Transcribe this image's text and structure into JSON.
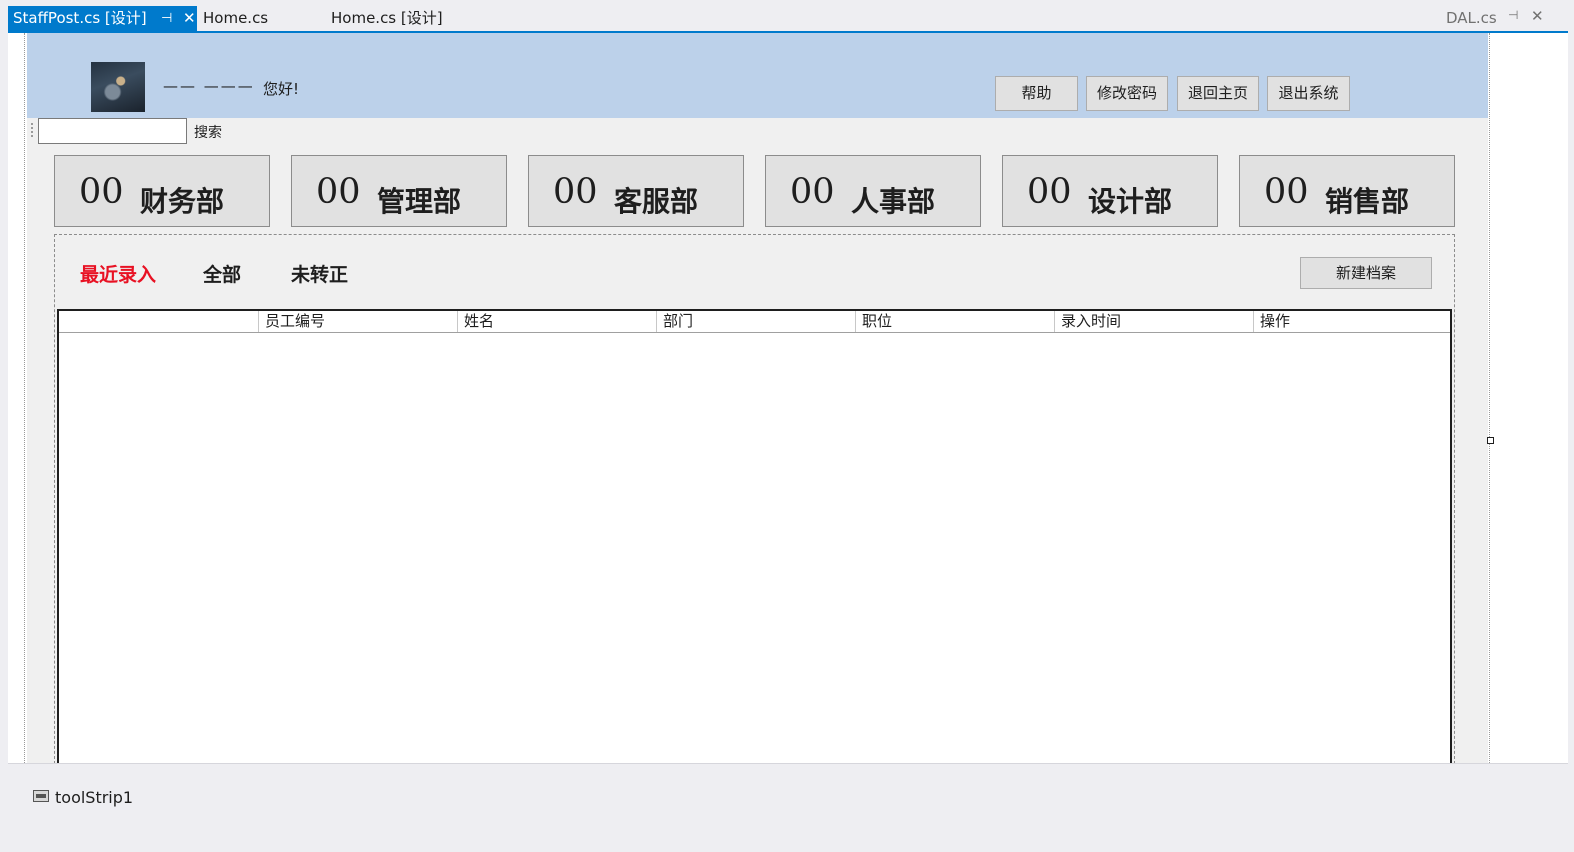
{
  "tabs": {
    "active": {
      "label": "StaffPost.cs [设计]",
      "pin_glyph": "⊣",
      "close_glyph": "✕"
    },
    "others": [
      "Home.cs",
      "Home.cs [设计]"
    ],
    "right": {
      "label": "DAL.cs",
      "pin_glyph": "⊣",
      "close_glyph": "✕"
    }
  },
  "header": {
    "avatar_icon": "user-avatar-image",
    "name_placeholder": "——  ———",
    "greeting": "您好!",
    "buttons": [
      "帮助",
      "修改密码",
      "退回主页",
      "退出系统"
    ]
  },
  "search": {
    "value": "",
    "label": "搜索"
  },
  "departments": [
    {
      "count": "00",
      "name": "财务部"
    },
    {
      "count": "00",
      "name": "管理部"
    },
    {
      "count": "00",
      "name": "客服部"
    },
    {
      "count": "00",
      "name": "人事部"
    },
    {
      "count": "00",
      "name": "设计部"
    },
    {
      "count": "00",
      "name": "销售部"
    }
  ],
  "filters": {
    "items": [
      "最近录入",
      "全部",
      "未转正"
    ],
    "active": "最近录入",
    "active_color": "#e81123"
  },
  "new_button": "新建档案",
  "grid": {
    "columns": [
      "",
      "员工编号",
      "姓名",
      "部门",
      "职位",
      "录入时间",
      "操作"
    ],
    "rows": []
  },
  "tray": {
    "component": "toolStrip1",
    "icon": "toolstrip-icon"
  },
  "colors": {
    "accent": "#007acc",
    "header_bg": "#bcd1ea",
    "button_bg": "#e1e1e1"
  }
}
